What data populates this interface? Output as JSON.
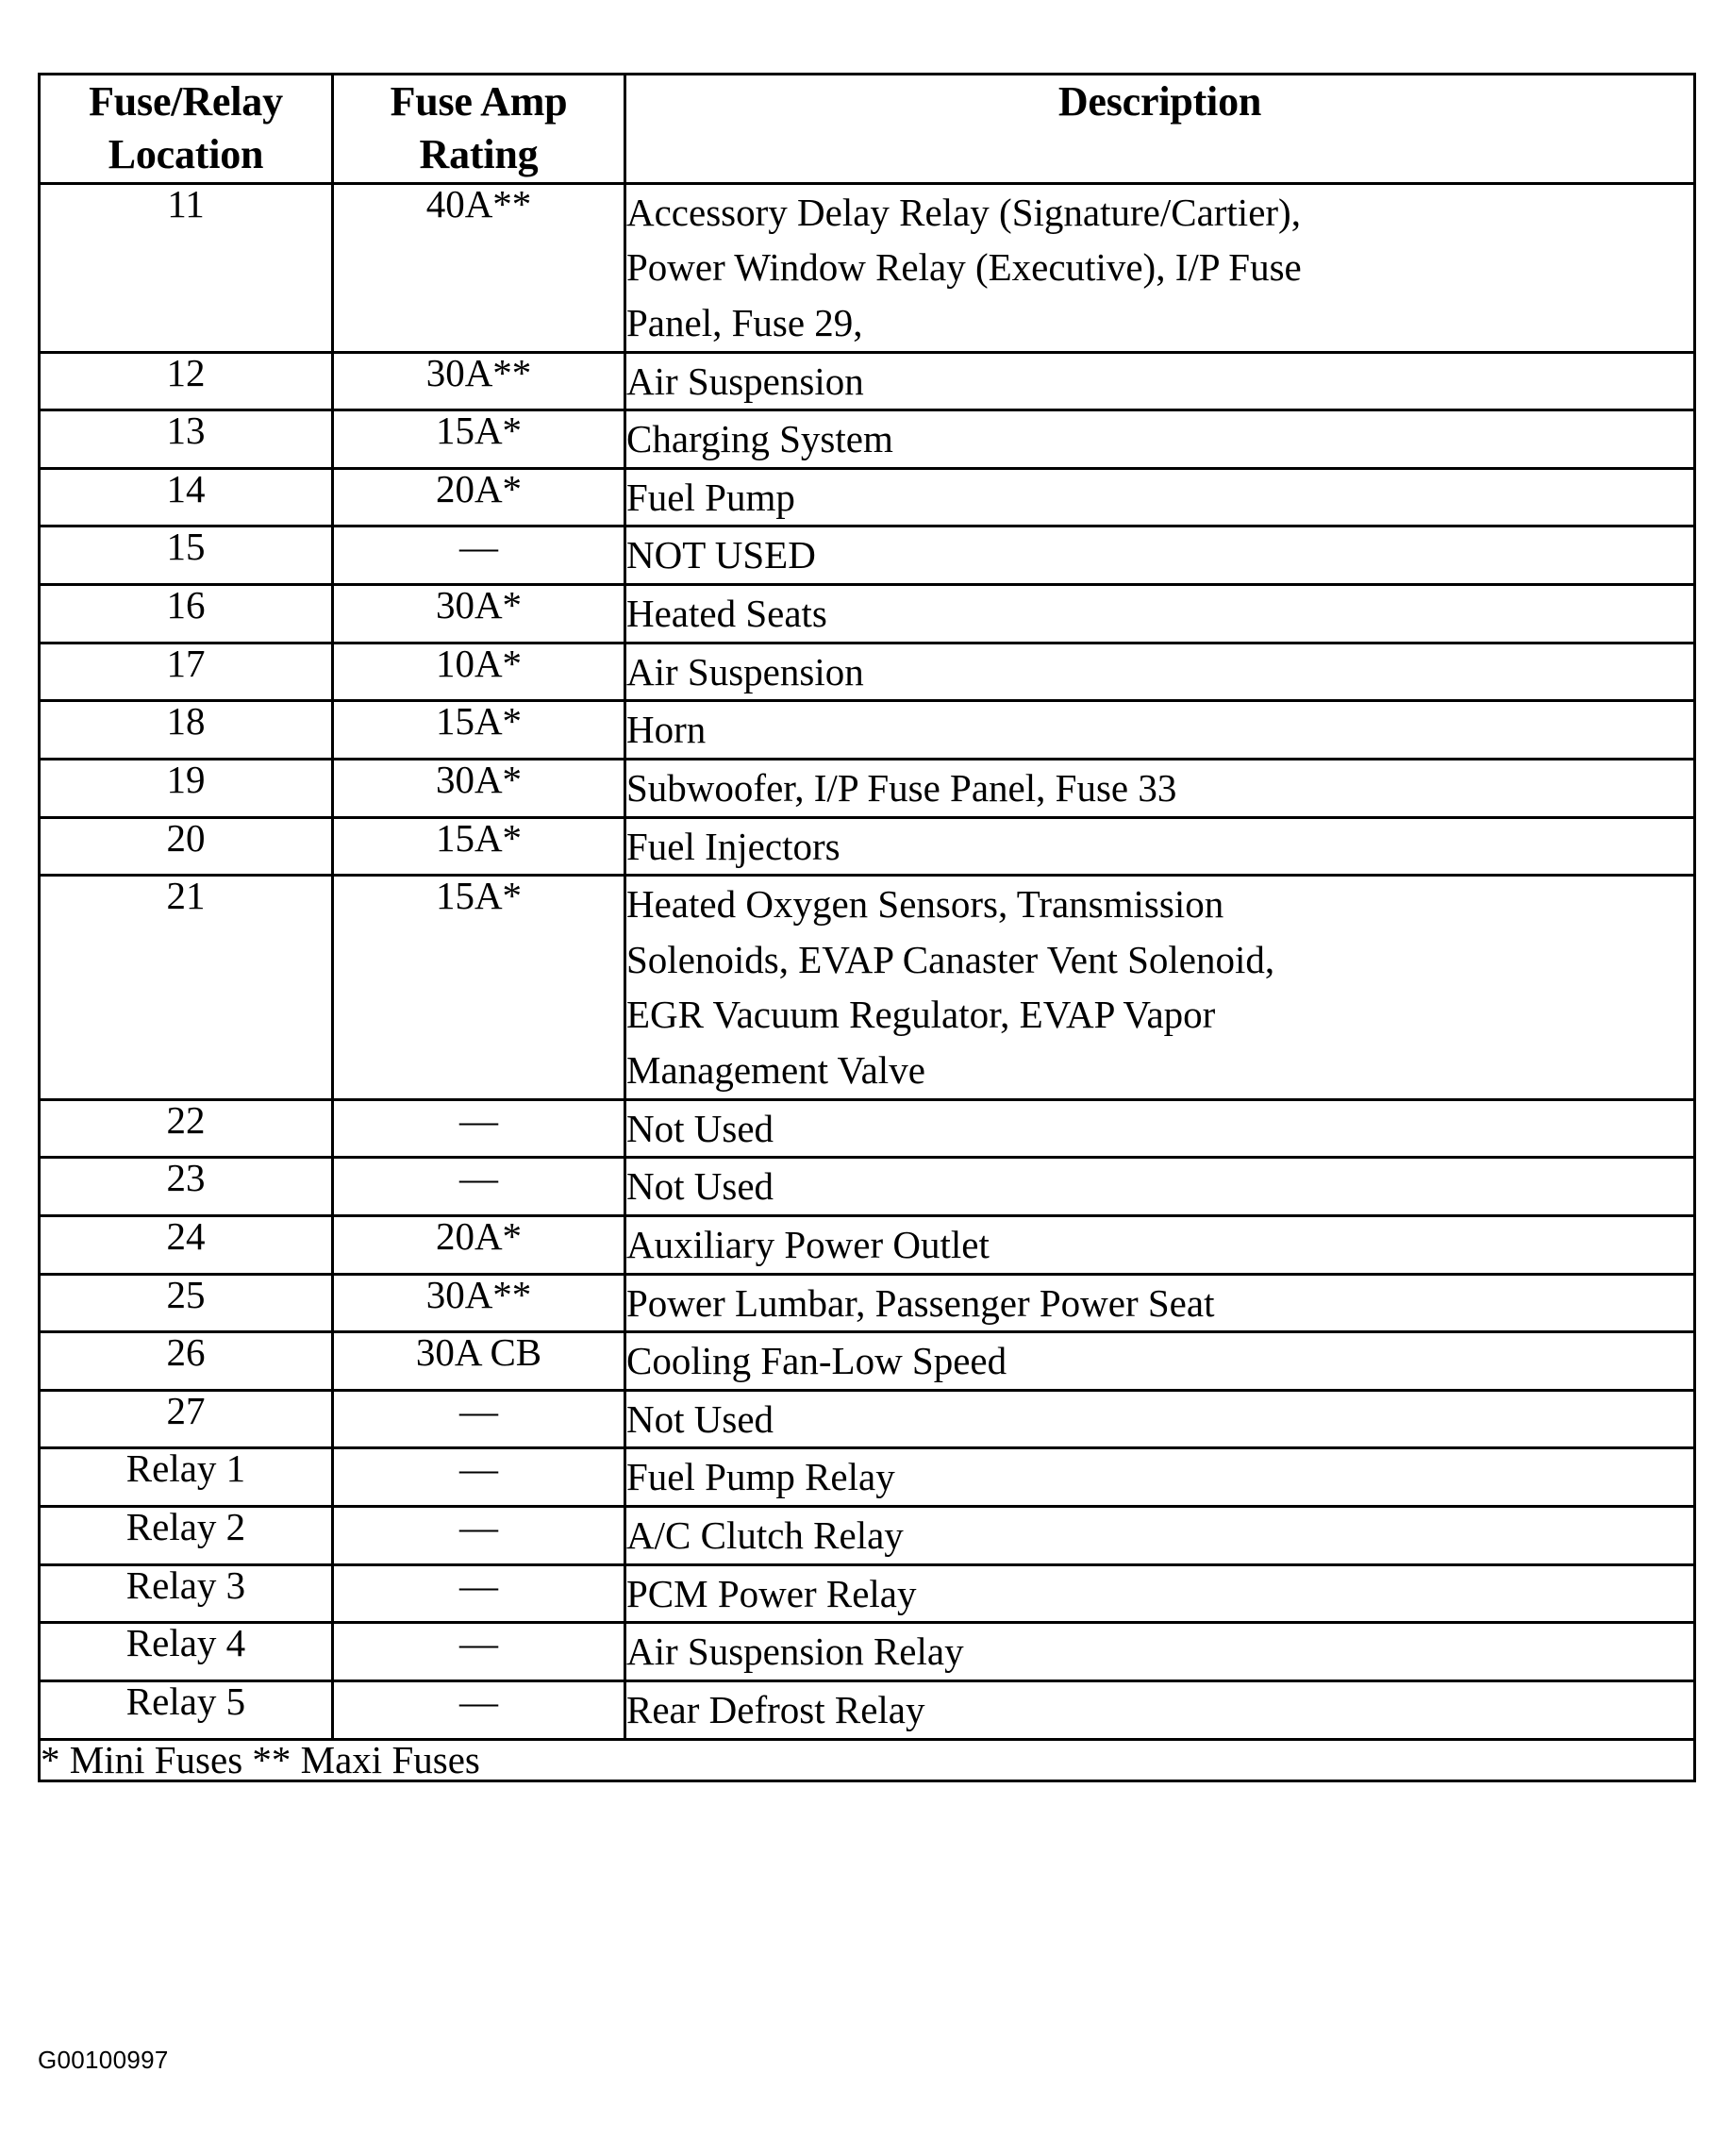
{
  "table": {
    "headers": {
      "location": "Fuse/Relay Location",
      "location_line1": "Fuse/Relay",
      "location_line2": "Location",
      "amp": "Fuse Amp Rating",
      "amp_line1": "Fuse Amp",
      "amp_line2": "Rating",
      "description": "Description"
    },
    "rows": [
      {
        "location": "11",
        "amp": "40A**",
        "description": "Accessory Delay Relay (Signature/Cartier), Power Window Relay (Executive), I/P Fuse Panel, Fuse 29,",
        "description_lines": [
          "Accessory Delay Relay (Signature/Cartier),",
          "Power Window Relay (Executive), I/P Fuse",
          "Panel, Fuse 29,"
        ]
      },
      {
        "location": "12",
        "amp": "30A**",
        "description": "Air Suspension",
        "description_lines": [
          "Air Suspension"
        ]
      },
      {
        "location": "13",
        "amp": "15A*",
        "description": "Charging System",
        "description_lines": [
          "Charging System"
        ]
      },
      {
        "location": "14",
        "amp": "20A*",
        "description": "Fuel Pump",
        "description_lines": [
          "Fuel Pump"
        ]
      },
      {
        "location": "15",
        "amp": "—",
        "description": "NOT USED",
        "description_lines": [
          "NOT USED"
        ]
      },
      {
        "location": "16",
        "amp": "30A*",
        "description": "Heated Seats",
        "description_lines": [
          "Heated Seats"
        ]
      },
      {
        "location": "17",
        "amp": "10A*",
        "description": "Air Suspension",
        "description_lines": [
          "Air Suspension"
        ]
      },
      {
        "location": "18",
        "amp": "15A*",
        "description": "Horn",
        "description_lines": [
          "Horn"
        ]
      },
      {
        "location": "19",
        "amp": "30A*",
        "description": "Subwoofer, I/P Fuse Panel, Fuse 33",
        "description_lines": [
          "Subwoofer, I/P Fuse Panel, Fuse 33"
        ]
      },
      {
        "location": "20",
        "amp": "15A*",
        "description": "Fuel Injectors",
        "description_lines": [
          "Fuel Injectors"
        ]
      },
      {
        "location": "21",
        "amp": "15A*",
        "description": "Heated Oxygen Sensors, Transmission Solenoids, EVAP Canaster Vent Solenoid, EGR Vacuum Regulator, EVAP Vapor Management Valve",
        "description_lines": [
          "Heated Oxygen Sensors, Transmission",
          "Solenoids, EVAP Canaster Vent Solenoid,",
          "EGR Vacuum Regulator, EVAP Vapor",
          "Management Valve"
        ]
      },
      {
        "location": "22",
        "amp": "—",
        "description": "Not Used",
        "description_lines": [
          "Not Used"
        ]
      },
      {
        "location": "23",
        "amp": "—",
        "description": "Not Used",
        "description_lines": [
          "Not Used"
        ]
      },
      {
        "location": "24",
        "amp": "20A*",
        "description": "Auxiliary Power Outlet",
        "description_lines": [
          "Auxiliary Power Outlet"
        ]
      },
      {
        "location": "25",
        "amp": "30A**",
        "description": "Power Lumbar, Passenger Power Seat",
        "description_lines": [
          "Power Lumbar, Passenger Power Seat"
        ]
      },
      {
        "location": "26",
        "amp": "30A CB",
        "description": "Cooling Fan-Low Speed",
        "description_lines": [
          "Cooling Fan-Low Speed"
        ]
      },
      {
        "location": "27",
        "amp": "—",
        "description": "Not Used",
        "description_lines": [
          "Not Used"
        ]
      },
      {
        "location": "Relay 1",
        "amp": "—",
        "description": "Fuel Pump Relay",
        "description_lines": [
          "Fuel Pump Relay"
        ]
      },
      {
        "location": "Relay 2",
        "amp": "—",
        "description": "A/C Clutch Relay",
        "description_lines": [
          "A/C Clutch Relay"
        ]
      },
      {
        "location": "Relay 3",
        "amp": "—",
        "description": "PCM Power Relay",
        "description_lines": [
          "PCM Power Relay"
        ]
      },
      {
        "location": "Relay 4",
        "amp": "—",
        "description": "Air Suspension Relay",
        "description_lines": [
          "Air Suspension Relay"
        ]
      },
      {
        "location": "Relay 5",
        "amp": "—",
        "description": "Rear Defrost Relay",
        "description_lines": [
          "Rear Defrost Relay"
        ]
      }
    ],
    "footnote": "* Mini Fuses ** Maxi Fuses"
  },
  "figure_id": "G00100997",
  "colors": {
    "ink": "#000000",
    "paper": "#ffffff"
  }
}
